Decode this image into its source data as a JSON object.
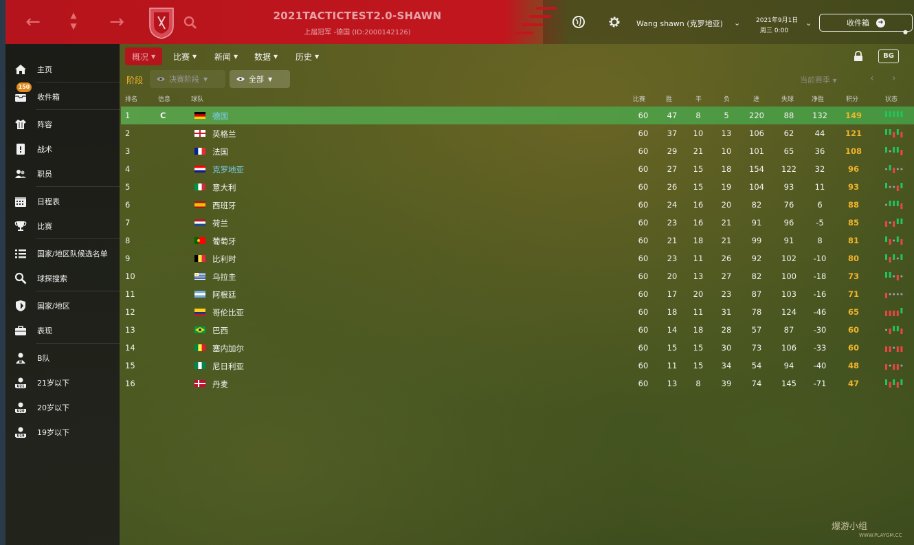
{
  "header": {
    "title": "2021TACTICTEST2.0-SHAWN",
    "subtitle": "上届冠军 -德国 (ID:2000142126)",
    "user": "Wang shawn (克罗地亚)",
    "date": "2021年9月1日",
    "time": "周三 0:00",
    "inbox_label": "收件箱"
  },
  "sidebar": {
    "items": [
      {
        "label": "主页",
        "icon": "home-icon"
      },
      {
        "label": "收件箱",
        "icon": "inbox-icon",
        "badge": "150"
      },
      {
        "label": "阵容",
        "icon": "shirt-icon"
      },
      {
        "label": "战术",
        "icon": "tactics-board-icon"
      },
      {
        "label": "职员",
        "icon": "staff-icon"
      },
      {
        "label": "日程表",
        "icon": "calendar-icon"
      },
      {
        "label": "比赛",
        "icon": "trophy-icon"
      },
      {
        "label": "国家/地区队候选名单",
        "icon": "list-icon"
      },
      {
        "label": "球探搜索",
        "icon": "search-icon"
      },
      {
        "label": "国家/地区",
        "icon": "shield-icon"
      },
      {
        "label": "表现",
        "icon": "briefcase-icon"
      },
      {
        "label": "B队",
        "icon": "team-b-icon",
        "tag": "B"
      },
      {
        "label": "21岁以下",
        "icon": "team-u21-icon",
        "tag": "U21"
      },
      {
        "label": "20岁以下",
        "icon": "team-u20-icon",
        "tag": "U20"
      },
      {
        "label": "19岁以下",
        "icon": "team-u19-icon",
        "tag": "U19"
      }
    ]
  },
  "tabs": [
    {
      "label": "概况",
      "active": true
    },
    {
      "label": "比赛",
      "active": false
    },
    {
      "label": "新闻",
      "active": false
    },
    {
      "label": "数据",
      "active": false
    },
    {
      "label": "历史",
      "active": false
    }
  ],
  "filters": {
    "stage_label": "阶段",
    "stage_dropdown": "决赛阶段",
    "scope_dropdown": "全部",
    "season_dropdown": "当前赛季"
  },
  "table": {
    "headers": {
      "pos": "排名",
      "info": "信息",
      "team": "球队",
      "played": "比赛",
      "won": "胜",
      "drawn": "平",
      "lost": "负",
      "gf": "进",
      "ga": "失球",
      "gd": "净胜",
      "pts": "积分",
      "form": "状态"
    },
    "rows": [
      {
        "pos": "1",
        "info": "C",
        "team": "德国",
        "flag": [
          "#000000",
          "#dd0000",
          "#ffce00"
        ],
        "flag_type": "h3",
        "p": "60",
        "w": "47",
        "d": "8",
        "l": "5",
        "gf": "220",
        "ga": "88",
        "gd": "132",
        "pts": "149",
        "highlight": true,
        "link": true,
        "form": "WWWWW"
      },
      {
        "pos": "2",
        "info": "",
        "team": "英格兰",
        "flag": [
          "#ffffff",
          "#cf142b"
        ],
        "flag_type": "cross",
        "p": "60",
        "w": "37",
        "d": "10",
        "l": "13",
        "gf": "106",
        "ga": "62",
        "gd": "44",
        "pts": "121",
        "form": "WWLWL"
      },
      {
        "pos": "3",
        "info": "",
        "team": "法国",
        "flag": [
          "#002395",
          "#ffffff",
          "#ed2939"
        ],
        "flag_type": "v3",
        "p": "60",
        "w": "29",
        "d": "21",
        "l": "10",
        "gf": "101",
        "ga": "65",
        "gd": "36",
        "pts": "108",
        "form": "WDWWL"
      },
      {
        "pos": "4",
        "info": "",
        "team": "克罗地亚",
        "flag": [
          "#ff0000",
          "#ffffff",
          "#171796"
        ],
        "flag_type": "h3",
        "p": "60",
        "w": "27",
        "d": "15",
        "l": "18",
        "gf": "154",
        "ga": "122",
        "gd": "32",
        "pts": "96",
        "link": true,
        "form": "DWLDD"
      },
      {
        "pos": "5",
        "info": "",
        "team": "意大利",
        "flag": [
          "#009246",
          "#ffffff",
          "#ce2b37"
        ],
        "flag_type": "v3",
        "p": "60",
        "w": "26",
        "d": "15",
        "l": "19",
        "gf": "104",
        "ga": "93",
        "gd": "11",
        "pts": "93",
        "form": "WDDLW"
      },
      {
        "pos": "6",
        "info": "",
        "team": "西班牙",
        "flag": [
          "#aa151b",
          "#f1bf00",
          "#aa151b"
        ],
        "flag_type": "es",
        "p": "60",
        "w": "24",
        "d": "16",
        "l": "20",
        "gf": "82",
        "ga": "76",
        "gd": "6",
        "pts": "88",
        "form": "DWWWL"
      },
      {
        "pos": "7",
        "info": "",
        "team": "荷兰",
        "flag": [
          "#ae1c28",
          "#ffffff",
          "#21468b"
        ],
        "flag_type": "h3",
        "p": "60",
        "w": "23",
        "d": "16",
        "l": "21",
        "gf": "91",
        "ga": "96",
        "gd": "-5",
        "pts": "85",
        "form": "LDLWW"
      },
      {
        "pos": "8",
        "info": "",
        "team": "葡萄牙",
        "flag": [
          "#006600",
          "#ff0000"
        ],
        "flag_type": "pt",
        "p": "60",
        "w": "21",
        "d": "18",
        "l": "21",
        "gf": "99",
        "ga": "91",
        "gd": "8",
        "pts": "81",
        "form": "WLDWL"
      },
      {
        "pos": "9",
        "info": "",
        "team": "比利时",
        "flag": [
          "#000000",
          "#fae042",
          "#ed2939"
        ],
        "flag_type": "v3",
        "p": "60",
        "w": "23",
        "d": "11",
        "l": "26",
        "gf": "92",
        "ga": "102",
        "gd": "-10",
        "pts": "80",
        "form": "WLWDW"
      },
      {
        "pos": "10",
        "info": "",
        "team": "乌拉圭",
        "flag": [
          "#ffffff",
          "#0038a8"
        ],
        "flag_type": "stripes",
        "p": "60",
        "w": "20",
        "d": "13",
        "l": "27",
        "gf": "82",
        "ga": "100",
        "gd": "-18",
        "pts": "73",
        "form": "WWDLD"
      },
      {
        "pos": "11",
        "info": "",
        "team": "阿根廷",
        "flag": [
          "#74acdf",
          "#ffffff",
          "#74acdf"
        ],
        "flag_type": "h3",
        "p": "60",
        "w": "17",
        "d": "20",
        "l": "23",
        "gf": "87",
        "ga": "103",
        "gd": "-16",
        "pts": "71",
        "form": "LDDDD"
      },
      {
        "pos": "12",
        "info": "",
        "team": "哥伦比亚",
        "flag": [
          "#fcd116",
          "#003893",
          "#ce1126"
        ],
        "flag_type": "co",
        "p": "60",
        "w": "18",
        "d": "11",
        "l": "31",
        "gf": "78",
        "ga": "124",
        "gd": "-46",
        "pts": "65",
        "form": "LLLLW"
      },
      {
        "pos": "13",
        "info": "",
        "team": "巴西",
        "flag": [
          "#009c3b",
          "#ffdf00",
          "#002776"
        ],
        "flag_type": "br",
        "p": "60",
        "w": "14",
        "d": "18",
        "l": "28",
        "gf": "57",
        "ga": "87",
        "gd": "-30",
        "pts": "60",
        "form": "DLWWL"
      },
      {
        "pos": "14",
        "info": "",
        "team": "塞内加尔",
        "flag": [
          "#00853f",
          "#fdef42",
          "#e31b23"
        ],
        "flag_type": "v3",
        "p": "60",
        "w": "15",
        "d": "15",
        "l": "30",
        "gf": "73",
        "ga": "106",
        "gd": "-33",
        "pts": "60",
        "form": "LLDLL"
      },
      {
        "pos": "15",
        "info": "",
        "team": "尼日利亚",
        "flag": [
          "#008751",
          "#ffffff",
          "#008751"
        ],
        "flag_type": "v3",
        "p": "60",
        "w": "11",
        "d": "15",
        "l": "34",
        "gf": "54",
        "ga": "94",
        "gd": "-40",
        "pts": "48",
        "form": "LDLLD"
      },
      {
        "pos": "16",
        "info": "",
        "team": "丹麦",
        "flag": [
          "#c60c30",
          "#ffffff"
        ],
        "flag_type": "nordic",
        "p": "60",
        "w": "13",
        "d": "8",
        "l": "39",
        "gf": "74",
        "ga": "145",
        "gd": "-71",
        "pts": "47",
        "form": "WLWLW"
      }
    ]
  },
  "colors": {
    "brand_red": "#b5141c",
    "points": "#f1b52b",
    "link": "#7dd3f5",
    "form_win": "#22c55e",
    "form_loss": "#ef4444",
    "form_draw": "#9ca3af"
  },
  "watermark": {
    "text": "爆游小组",
    "url": "WWW.PLAYGM.CC"
  }
}
